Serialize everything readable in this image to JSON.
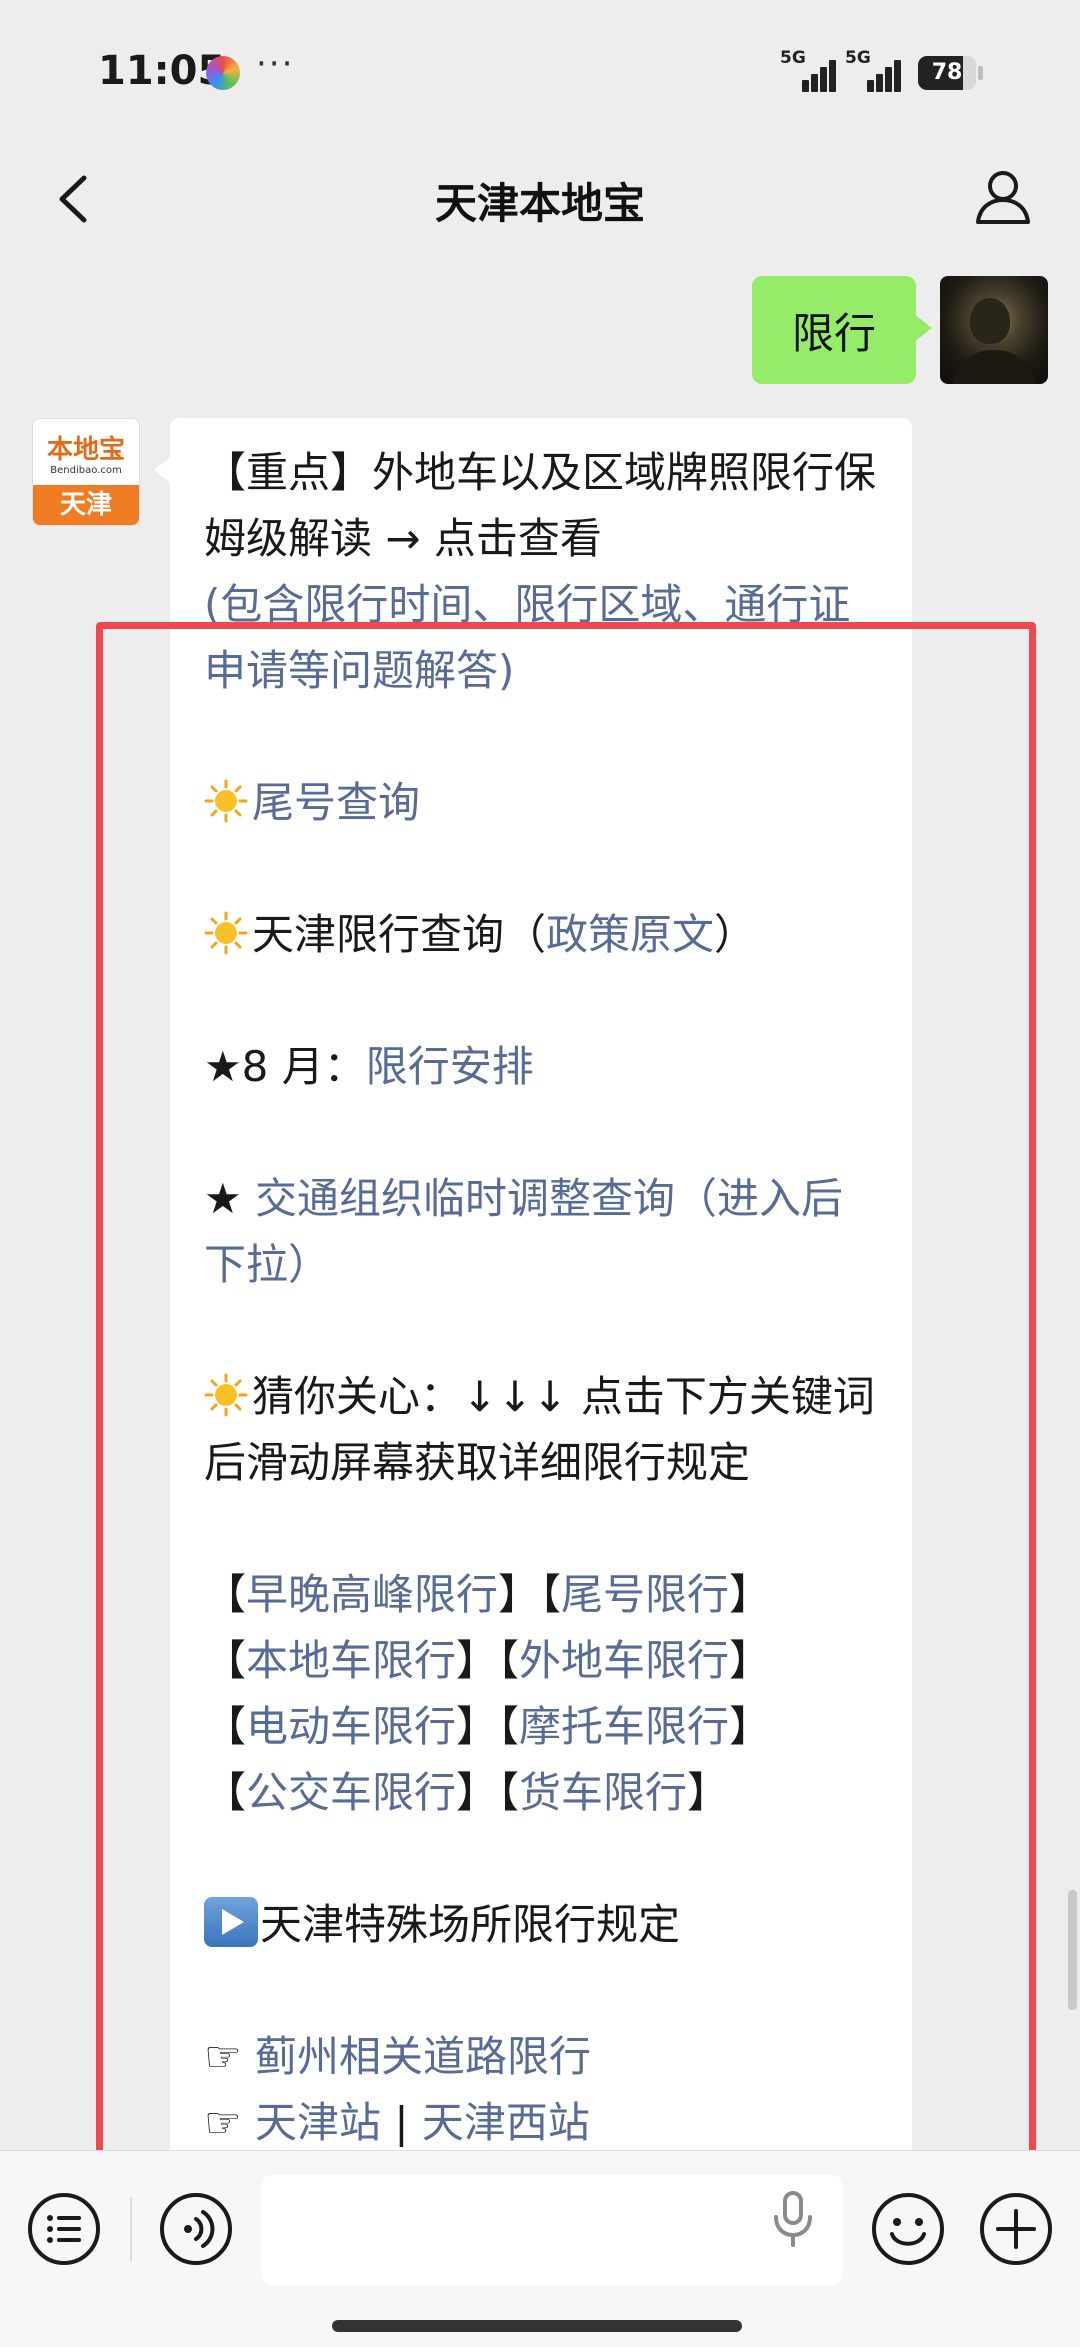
{
  "status_bar": {
    "time": "11:05",
    "more": "···",
    "signal_1": "5G",
    "signal_2": "5G",
    "battery_level": 78
  },
  "nav": {
    "back_icon": "chevron-left-icon",
    "title": "天津本地宝",
    "profile_icon": "person-icon"
  },
  "chat": {
    "outgoing_message": "限行",
    "bot_avatar": {
      "name": "本地宝",
      "site": "Bendibao.com",
      "city": "天津"
    },
    "incoming": {
      "line1": "【重点】外地车以及区域牌照限行保姆级解读 → 点击查看",
      "line1_note": "(包含限行时间、限行区域、通行证申请等问题解答)",
      "item_tail_query": "尾号查询",
      "item_policy_prefix": "天津限行查询（",
      "item_policy_link": "政策原文",
      "item_policy_suffix": "）",
      "item_aug_prefix": "★8 月：",
      "item_aug_link": "限行安排",
      "item_traffic_prefix": "★ ",
      "item_traffic_link": "交通组织临时调整查询（进入后下拉）",
      "guess_text": "猜你关心：↓↓↓ 点击下方关键词后滑动屏幕获取详细限行规定",
      "keywords": [
        [
          "早晚高峰限行",
          "尾号限行"
        ],
        [
          "本地车限行",
          "外地车限行"
        ],
        [
          "电动车限行",
          "摩托车限行"
        ],
        [
          "公交车限行",
          "货车限行"
        ]
      ],
      "special_title": "天津特殊场所限行规定",
      "hand_icon": "☞",
      "special_link_1": "蓟州相关道路限行",
      "special_link_2a": "天津站",
      "special_sep": "|",
      "special_link_2b": "天津西站"
    }
  },
  "colors": {
    "link": "#576b95",
    "outgoing_bubble": "#95ec69",
    "highlight_box": "#f0484f",
    "background": "#ededed"
  },
  "input_bar": {
    "menu_icon": "list-menu-icon",
    "voice_icon": "voice-wave-icon",
    "mic_icon": "microphone-icon",
    "emoji_icon": "smiley-icon",
    "plus_icon": "plus-circle-icon"
  }
}
